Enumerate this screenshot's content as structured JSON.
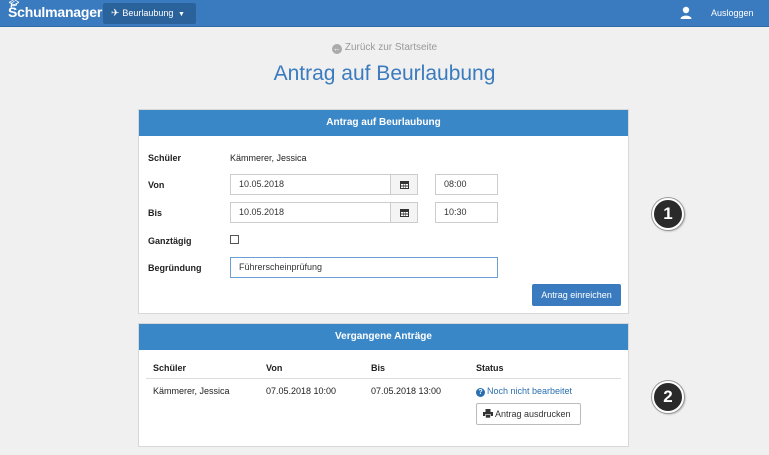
{
  "navbar": {
    "brand": "Schulmanager",
    "menu_label": "Beurlaubung",
    "logout_label": "Ausloggen"
  },
  "back_link": "Zurück zur Startseite",
  "page_title": "Antrag auf Beurlaubung",
  "form": {
    "heading": "Antrag auf Beurlaubung",
    "student_label": "Schüler",
    "student_value": "Kämmerer, Jessica",
    "from_label": "Von",
    "from_date": "10.05.2018",
    "from_time": "08:00",
    "to_label": "Bis",
    "to_date": "10.05.2018",
    "to_time": "10:30",
    "allday_label": "Ganztägig",
    "allday_checked": false,
    "reason_label": "Begründung",
    "reason_value": "Führerscheinprüfung",
    "submit_label": "Antrag einreichen"
  },
  "past": {
    "heading": "Vergangene Anträge",
    "columns": [
      "Schüler",
      "Von",
      "Bis",
      "Status"
    ],
    "rows": [
      {
        "student": "Kämmerer, Jessica",
        "from": "07.05.2018 10:00",
        "to": "07.05.2018 13:00",
        "status": "Noch nicht bearbeitet",
        "print_label": "Antrag ausdrucken"
      }
    ]
  },
  "markers": [
    "1",
    "2"
  ],
  "colors": {
    "primary": "#3a7bbf",
    "panel_header": "#3a87c8",
    "background": "#f0f0f0"
  }
}
